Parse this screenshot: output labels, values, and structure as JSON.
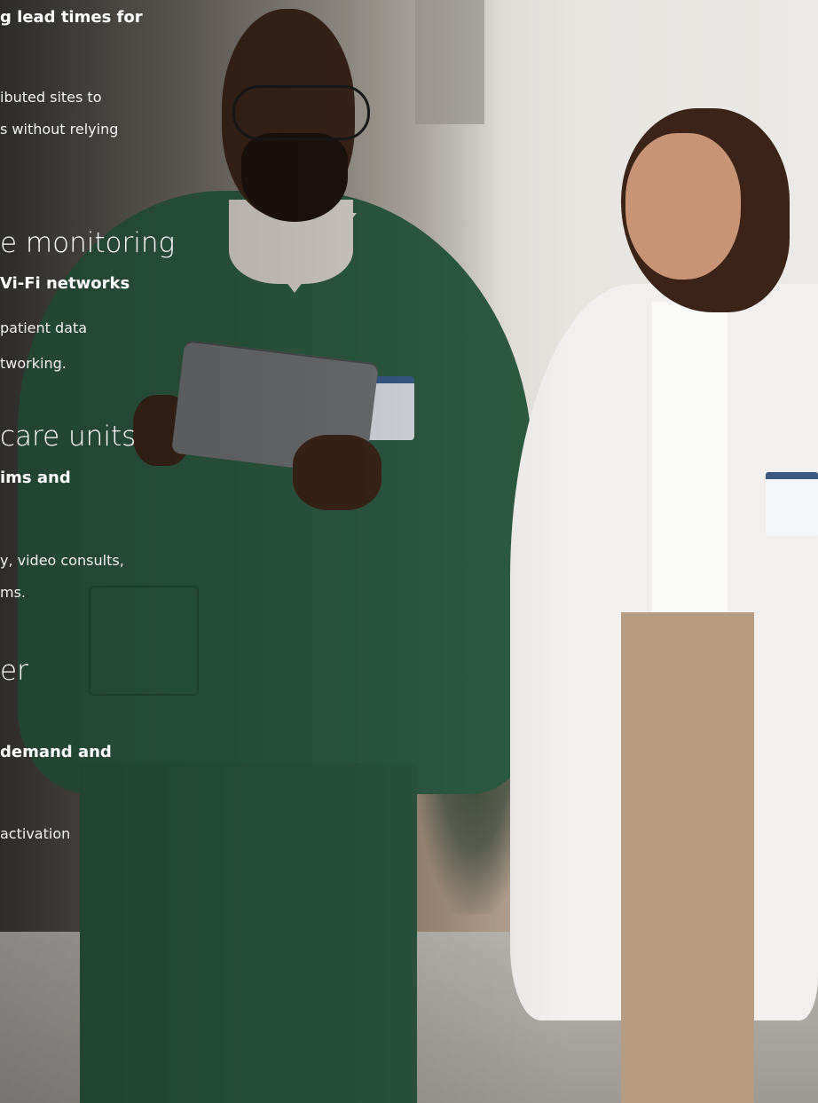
{
  "sections": [
    {
      "heading": "",
      "subheading": "g lead times for",
      "body": [
        "ibuted sites to",
        "s without relying"
      ]
    },
    {
      "heading": "e monitoring",
      "subheading": "Vi-Fi networks",
      "body": [
        "patient data",
        "tworking."
      ]
    },
    {
      "heading": "care units",
      "subheading": "ims and",
      "body": [
        "y, video consults,",
        "ms."
      ]
    },
    {
      "heading": "er",
      "subheading": "demand and",
      "body": [
        "activation"
      ]
    }
  ]
}
